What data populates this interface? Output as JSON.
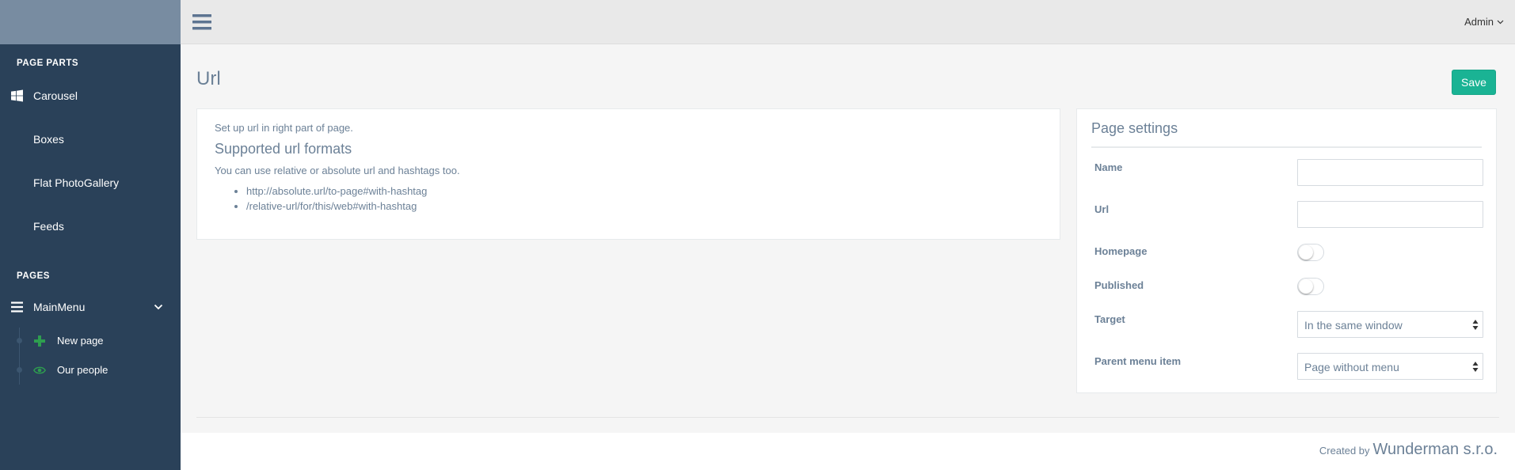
{
  "sidebar": {
    "section_page_parts": "PAGE PARTS",
    "page_parts": [
      {
        "label": "Carousel",
        "icon": "windows-icon"
      },
      {
        "label": "Boxes",
        "icon": ""
      },
      {
        "label": "Flat PhotoGallery",
        "icon": ""
      },
      {
        "label": "Feeds",
        "icon": ""
      }
    ],
    "section_pages": "PAGES",
    "main_menu": {
      "label": "MainMenu",
      "icon": "bars-icon"
    },
    "sub_items": [
      {
        "label": "New page",
        "icon": "plus-icon"
      },
      {
        "label": "Our people",
        "icon": "eye-icon"
      }
    ]
  },
  "header": {
    "user_label": "Admin"
  },
  "main": {
    "title": "Url",
    "save_label": "Save",
    "info": {
      "intro": "Set up url in right part of page.",
      "heading": "Supported url formats",
      "description": "You can use relative or absolute url and hashtags too.",
      "examples": [
        "http://absolute.url/to-page#with-hashtag",
        "/relative-url/for/this/web#with-hashtag"
      ]
    },
    "settings": {
      "title": "Page settings",
      "name_label": "Name",
      "name_value": "",
      "url_label": "Url",
      "url_value": "",
      "homepage_label": "Homepage",
      "homepage_on": false,
      "published_label": "Published",
      "published_on": false,
      "target_label": "Target",
      "target_value": "In the same window",
      "parent_label": "Parent menu item",
      "parent_value": "Page without menu"
    }
  },
  "footer": {
    "created_by": "Created by",
    "company": "Wunderman s.r.o."
  },
  "colors": {
    "sidebar_bg": "#2a4159",
    "accent": "#1ab394",
    "icon_green": "#2e9e4f"
  }
}
